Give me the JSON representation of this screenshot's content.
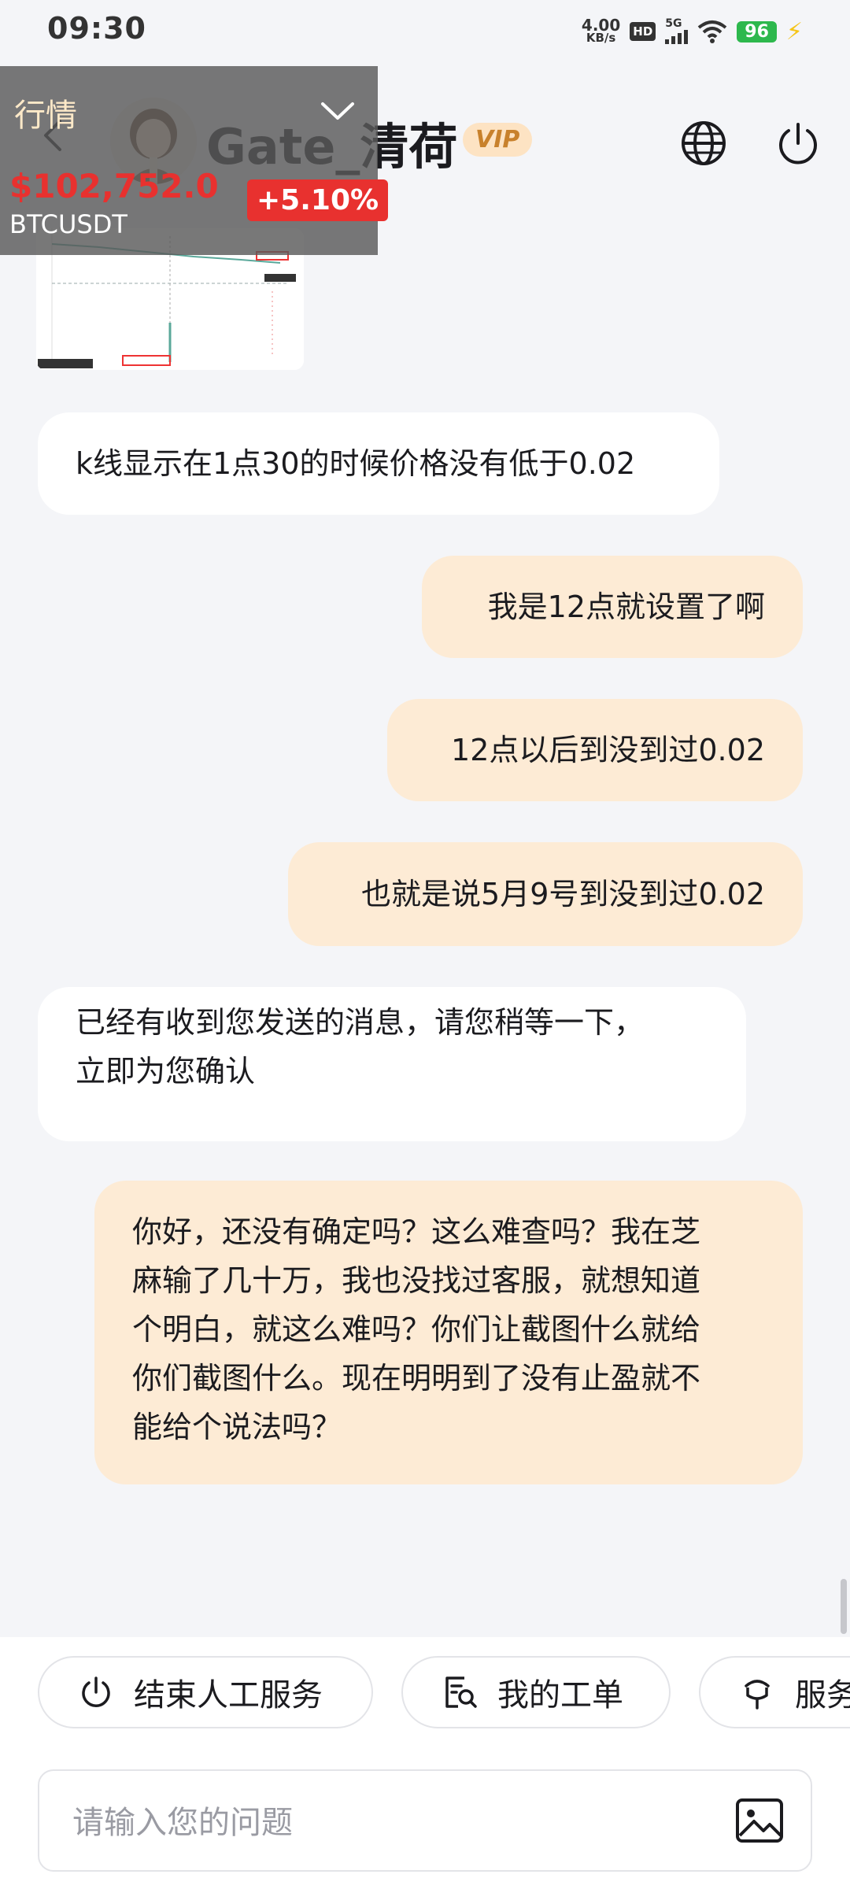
{
  "status_bar": {
    "time": "09:30",
    "net_speed_value": "4.00",
    "net_speed_unit": "KB/s",
    "hd_badge": "HD",
    "network_type": "5G",
    "battery": "96"
  },
  "header": {
    "title": "Gate_清荷",
    "vip_badge": "VIP"
  },
  "ticker": {
    "label": "行情",
    "price": "$102,752.0",
    "change": "+5.10%",
    "symbol": "BTCUSDT"
  },
  "messages": [
    {
      "side": "incoming",
      "text": "k线显示在1点30的时候价格没有低于0.02"
    },
    {
      "side": "outgoing",
      "text": "我是12点就设置了啊"
    },
    {
      "side": "outgoing",
      "text": "12点以后到没到过0.02"
    },
    {
      "side": "outgoing",
      "text": "也就是说5月9号到没到过0.02"
    },
    {
      "side": "incoming",
      "lines": [
        "已经有收到您发送的消息，请您稍等一下，",
        "立即为您确认"
      ]
    },
    {
      "side": "outgoing",
      "lines": [
        "你好，还没有确定吗？这么难查吗？我在芝",
        "麻输了几十万，我也没找过客服，就想知道",
        "个明白，就这么难吗？你们让截图什么就给",
        "你们截图什么。现在明明到了没有止盈就不",
        "能给个说法吗？"
      ]
    }
  ],
  "actions": {
    "end_service": "结束人工服务",
    "my_tickets": "我的工单",
    "service": "服务"
  },
  "input": {
    "placeholder": "请输入您的问题"
  },
  "colors": {
    "outgoing_bubble": "#fdebd5",
    "incoming_bubble": "#ffffff",
    "price_red": "#e8312f",
    "vip_bg": "#fde3c3"
  }
}
